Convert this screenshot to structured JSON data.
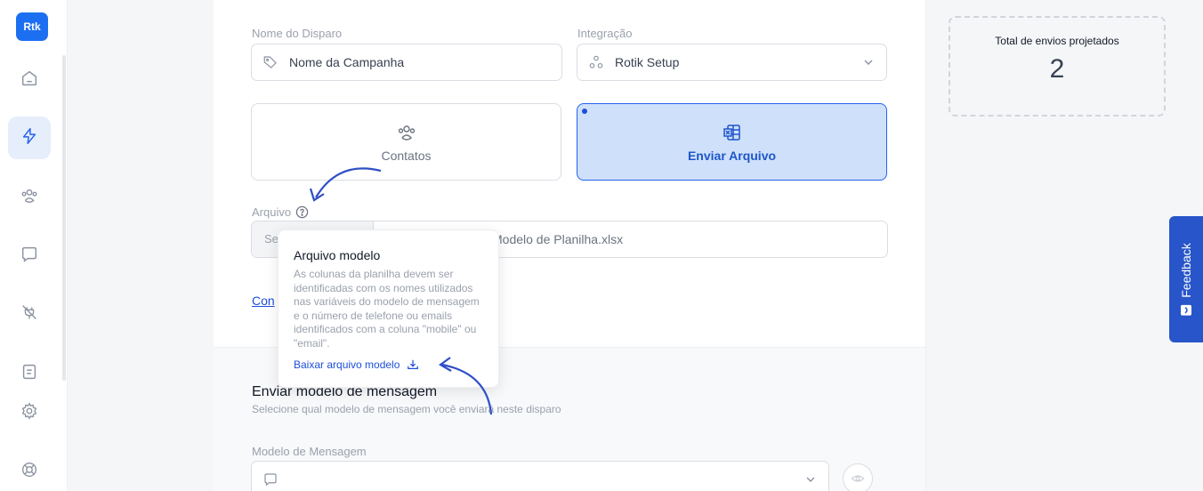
{
  "sidebar": {
    "logo": "Rtk",
    "items": [
      {
        "icon": "home-icon"
      },
      {
        "icon": "lightning-icon",
        "active": true
      },
      {
        "icon": "users-icon"
      },
      {
        "icon": "chat-icon"
      },
      {
        "icon": "plug-off-icon"
      },
      {
        "icon": "document-icon"
      },
      {
        "icon": "gear-icon"
      },
      {
        "icon": "lifebuoy-icon"
      }
    ]
  },
  "form": {
    "name_label": "Nome do Disparo",
    "name_value": "Nome da Campanha",
    "integration_label": "Integração",
    "integration_value": "Rotik Setup",
    "option_contacts": "Contatos",
    "option_upload": "Enviar Arquivo",
    "file_label": "Arquivo",
    "file_button": "Se",
    "file_name": "Modelo de Planilha.xlsx",
    "config_link": "Con"
  },
  "tooltip": {
    "title": "Arquivo modelo",
    "body": "As colunas da planilha devem ser identificadas com os nomes utilizados nas variáveis do modelo de mensagem e o número de telefone ou emails identificados com a coluna \"mobile\" ou \"email\".",
    "link": "Baixar arquivo modelo"
  },
  "message_section": {
    "title": "Enviar modelo de mensagem",
    "subtitle": "Selecione qual modelo de mensagem você enviará neste disparo",
    "model_label": "Modelo de Mensagem"
  },
  "summary": {
    "total_label": "Total de envios projetados",
    "total_value": "2"
  },
  "feedback": {
    "label": "Feedback"
  },
  "colors": {
    "accent": "#1d6ff2",
    "selected_card": "#cfe0fb",
    "feedback": "#2855c9",
    "annotation_arrow": "#2f4fc6"
  }
}
